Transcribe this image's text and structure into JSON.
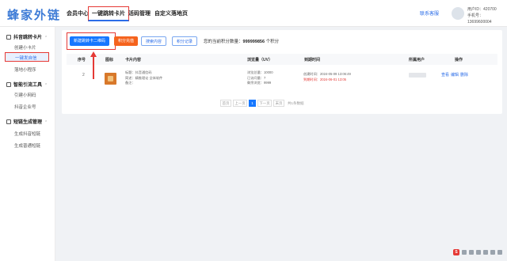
{
  "header": {
    "logo": "蜂家外链",
    "nav": [
      "会员中心",
      "一键跳转卡片",
      "活码管理",
      "自定义落地页"
    ],
    "service": "联系客服",
    "user_id": "用户ID：",
    "user_id_value": "420700",
    "phone": "手机号：",
    "phone_value": "13699600004"
  },
  "sidebar": {
    "group1": "抖音跳转卡片",
    "group1_items": [
      "创建小卡片",
      "一键发自信",
      "落地小程序"
    ],
    "group2": "智能引流工具",
    "group2_items": [
      "引建小网码",
      "抖音企业号"
    ],
    "group3": "短链生成管理",
    "group3_items": [
      "生成抖音短链",
      "生成普通短链"
    ]
  },
  "toolbar": {
    "create_btn": "新建跳转卡二维码",
    "recharge_btn": "积分充值",
    "search_btn": "搜索内容",
    "record_btn": "积分记录",
    "points_label": "您的当前积分数量：",
    "points_value": "999999856",
    "points_unit": "个积分"
  },
  "table": {
    "headers": [
      "序号",
      "图标",
      "卡片内容",
      "浏览量（UV）",
      "到期时间",
      "所属用户",
      "操作"
    ],
    "row": {
      "index": "2",
      "content_title": "标题：抖音通信码",
      "content_desc": "简述：精推理论 全体软件",
      "content_note": "备注：",
      "stat1": "浏览总量：10000",
      "stat2": "已访问量：7",
      "stat3": "剩余浏览：9999",
      "create_time": "创建时间：2024-05-09 13:06:49",
      "expire_time": "到期时间：2024-06-01 13:05",
      "ops": [
        "查看",
        "编辑",
        "删除"
      ]
    }
  },
  "pager": {
    "first": "首页",
    "prev": "上一页",
    "current": "1",
    "next": "下一页",
    "last": "末页",
    "total": "共1条数据"
  }
}
